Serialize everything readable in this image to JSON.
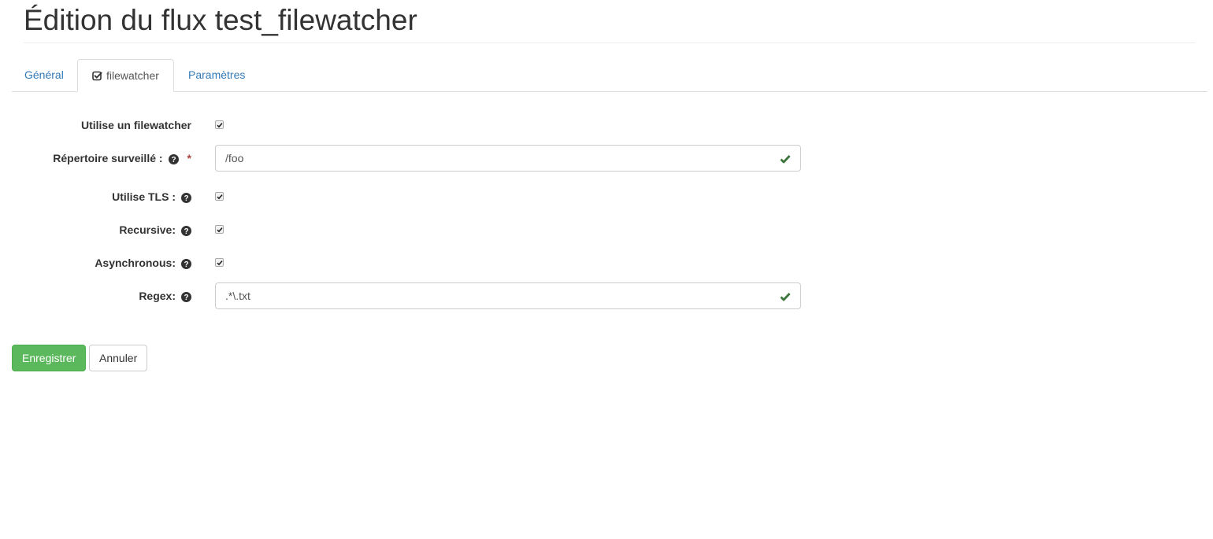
{
  "page": {
    "title": "Édition du flux test_filewatcher"
  },
  "tabs": [
    {
      "label": "Général",
      "active": false
    },
    {
      "label": "filewatcher",
      "active": true,
      "icon": "check-square-icon"
    },
    {
      "label": "Paramètres",
      "active": false
    }
  ],
  "form": {
    "use_filewatcher": {
      "label": "Utilise un filewatcher",
      "checked": true
    },
    "watched_directory": {
      "label": "Répertoire surveillé :",
      "required_mark": "*",
      "value": "/foo",
      "help_icon": "question-circle-icon",
      "valid_icon": "check-icon"
    },
    "use_tls": {
      "label": "Utilise TLS :",
      "checked": true,
      "help_icon": "question-circle-icon"
    },
    "recursive": {
      "label": "Recursive:",
      "checked": true,
      "help_icon": "question-circle-icon"
    },
    "asynchronous": {
      "label": "Asynchronous:",
      "checked": true,
      "help_icon": "question-circle-icon"
    },
    "regex": {
      "label": "Regex:",
      "value": ".*\\.txt",
      "help_icon": "question-circle-icon",
      "valid_icon": "check-icon"
    }
  },
  "actions": {
    "save_label": "Enregistrer",
    "cancel_label": "Annuler"
  },
  "colors": {
    "link": "#337ab7",
    "success": "#5cb85c",
    "valid_check": "#3c763d",
    "required": "#a94442"
  }
}
